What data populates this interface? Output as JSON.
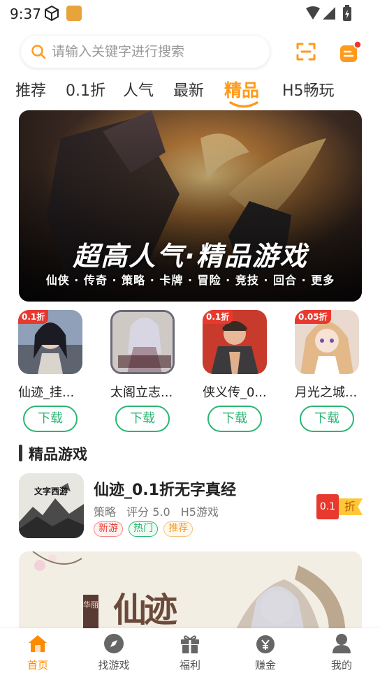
{
  "status_bar": {
    "time": "9:37"
  },
  "search": {
    "placeholder": "请输入关键字进行搜索"
  },
  "tabs": [
    {
      "label": "推荐"
    },
    {
      "label": "0.1折"
    },
    {
      "label": "人气"
    },
    {
      "label": "最新"
    },
    {
      "label": "精品",
      "active": true
    },
    {
      "label": "H5畅玩"
    }
  ],
  "banner": {
    "title": "超高人气·精品游戏",
    "subtitle": "仙侠 · 传奇 · 策略 · 卡牌 · 冒险 · 竞技 · 回合 · 更多"
  },
  "hgames": [
    {
      "name": "仙迹_挂...",
      "badge": "0.1折",
      "button": "下载"
    },
    {
      "name": "太阁立志...",
      "badge": "",
      "button": "下载"
    },
    {
      "name": "侠义传_0...",
      "badge": "0.1折",
      "button": "下载"
    },
    {
      "name": "月光之城...",
      "badge": "0.05折",
      "button": "下载"
    }
  ],
  "section": {
    "title": "精品游戏"
  },
  "featured_game": {
    "title": "仙迹_0.1折无字真经",
    "category": "策略",
    "rating": "评分 5.0",
    "type": "H5游戏",
    "tags": [
      "新游",
      "热门",
      "推荐"
    ],
    "discount_value": "0.1",
    "discount_label": "折",
    "icon_text": "文字西游"
  },
  "banner2": {
    "text": "仙迹",
    "side_text": "华丽"
  },
  "bottom_nav": [
    {
      "label": "首页",
      "icon": "home-icon",
      "active": true
    },
    {
      "label": "找游戏",
      "icon": "compass-icon"
    },
    {
      "label": "福利",
      "icon": "gift-icon"
    },
    {
      "label": "赚金",
      "icon": "money-bag-icon"
    },
    {
      "label": "我的",
      "icon": "user-icon"
    }
  ],
  "colors": {
    "accent": "#ff9a1c",
    "green": "#2bb673",
    "red": "#e8392e"
  }
}
